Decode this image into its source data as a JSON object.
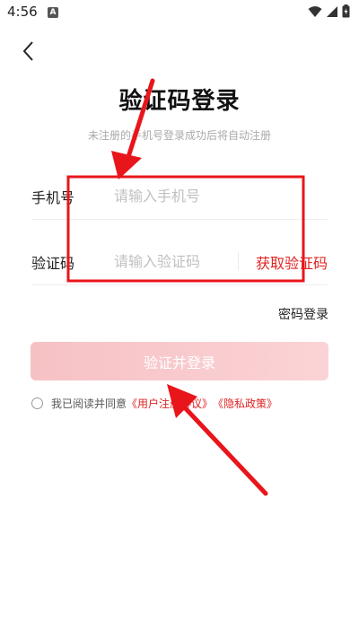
{
  "status_bar": {
    "time": "4:56",
    "notification_badge": "A"
  },
  "header": {
    "title": "验证码登录",
    "subtitle": "未注册的手机号登录成功后将自动注册"
  },
  "form": {
    "phone_label": "手机号",
    "phone_placeholder": "请输入手机号",
    "phone_value": "",
    "code_label": "验证码",
    "code_placeholder": "请输入验证码",
    "code_value": "",
    "get_code_label": "获取验证码"
  },
  "password_login_label": "密码登录",
  "submit_label": "验证并登录",
  "agreement": {
    "checked": false,
    "prefix": "我已阅读并同意",
    "user_agreement": "《用户注册协议》",
    "privacy_policy": "《隐私政策》"
  },
  "colors": {
    "accent": "#e02424",
    "button_bg": "#f8c8cb",
    "annotation": "#e8151b"
  }
}
